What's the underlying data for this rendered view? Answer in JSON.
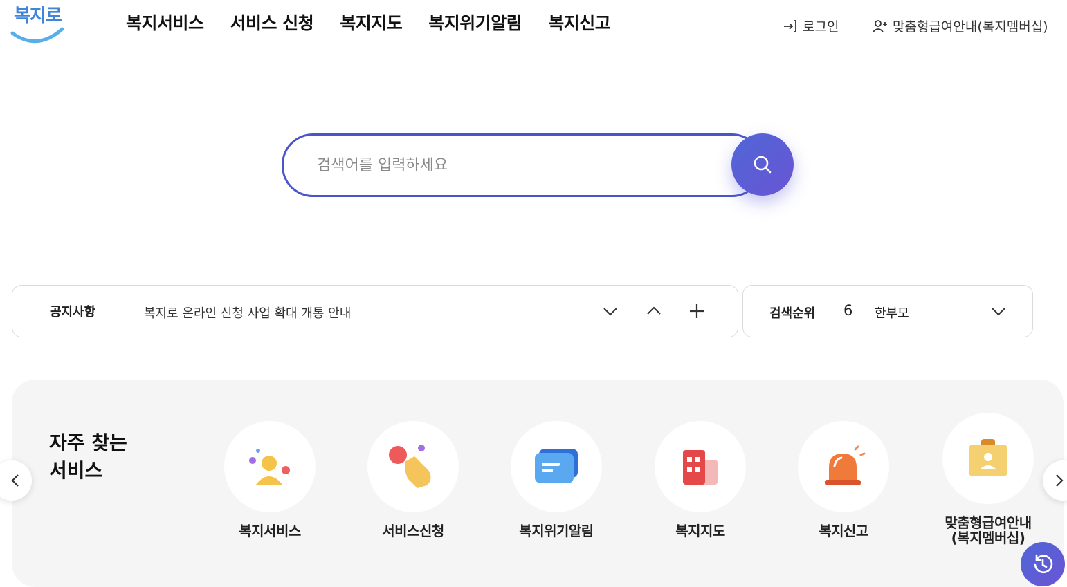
{
  "header": {
    "logo_text": "복지로",
    "nav": [
      "복지서비스",
      "서비스 신청",
      "복지지도",
      "복지위기알림",
      "복지신고"
    ],
    "login_label": "로그인",
    "member_label": "맞춤형급여안내(복지멤버십)"
  },
  "search": {
    "placeholder": "검색어를 입력하세요"
  },
  "notice": {
    "label": "공지사항",
    "text": "복지로 온라인 신청 사업 확대 개통 안내"
  },
  "ranking": {
    "label": "검색순위",
    "number": "6",
    "keyword": "한부모"
  },
  "frequent": {
    "title_line1": "자주 찾는",
    "title_line2": "서비스",
    "items": [
      {
        "label": "복지서비스",
        "icon": "person-icon"
      },
      {
        "label": "서비스신청",
        "icon": "hand-click-icon"
      },
      {
        "label": "복지위기알림",
        "icon": "message-icon"
      },
      {
        "label": "복지지도",
        "icon": "building-icon"
      },
      {
        "label": "복지신고",
        "icon": "siren-icon"
      },
      {
        "label": "맞춤형급여안내\n(복지멤버십)",
        "icon": "id-card-icon"
      }
    ]
  },
  "colors": {
    "accent": "#4a56c8",
    "logo": "#3f86d8"
  }
}
